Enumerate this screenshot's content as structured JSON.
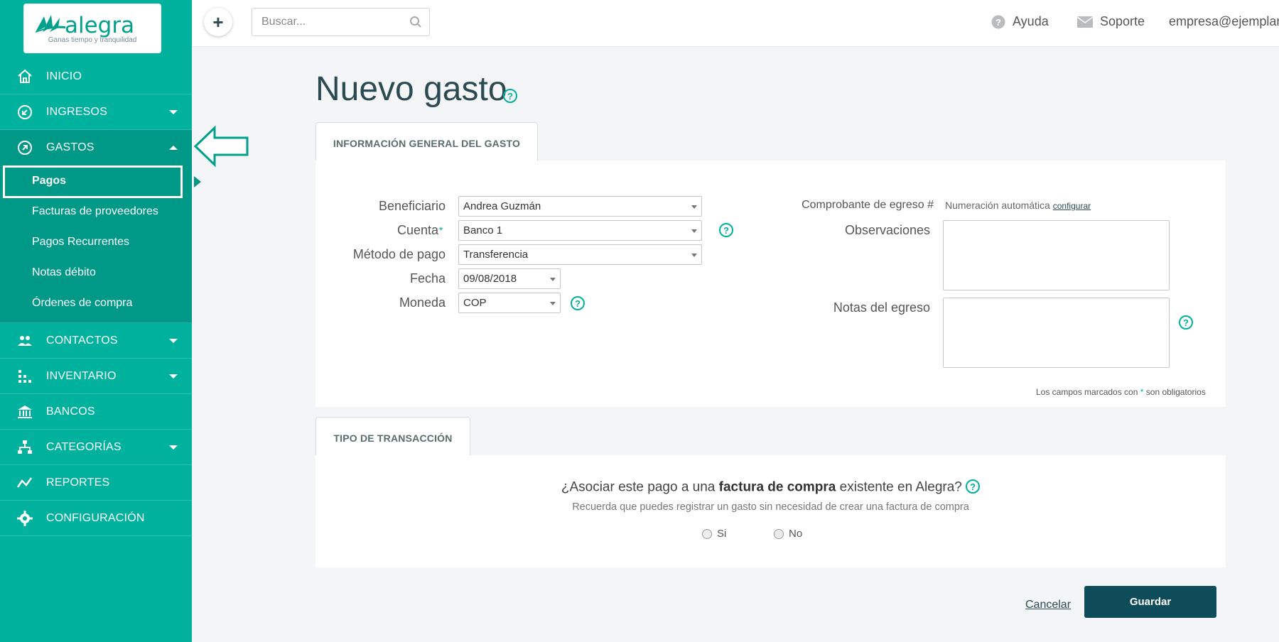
{
  "brand": {
    "name": "alegra",
    "tagline": "Ganas tiempo y tranquilidad",
    "primary_color": "#00b19d",
    "dark_color": "#0f4c5a"
  },
  "sidebar": {
    "items": [
      {
        "label": "INICIO",
        "icon": "home-icon"
      },
      {
        "label": "INGRESOS",
        "icon": "income-icon"
      },
      {
        "label": "GASTOS",
        "icon": "expense-icon"
      },
      {
        "label": "CONTACTOS",
        "icon": "contacts-icon"
      },
      {
        "label": "INVENTARIO",
        "icon": "inventory-icon"
      },
      {
        "label": "BANCOS",
        "icon": "bank-icon"
      },
      {
        "label": "CATEGORÍAS",
        "icon": "categories-icon"
      },
      {
        "label": "REPORTES",
        "icon": "reports-icon"
      },
      {
        "label": "CONFIGURACIÓN",
        "icon": "gear-icon"
      }
    ],
    "gastos_sub": [
      {
        "label": "Pagos"
      },
      {
        "label": "Facturas de proveedores"
      },
      {
        "label": "Pagos Recurrentes"
      },
      {
        "label": "Notas débito"
      },
      {
        "label": "Órdenes de compra"
      }
    ]
  },
  "topbar": {
    "add_label": "+",
    "search_placeholder": "Buscar...",
    "help_label": "Ayuda",
    "support_label": "Soporte",
    "user_email": "empresa@ejemplar."
  },
  "page": {
    "title": "Nuevo gasto"
  },
  "general_info": {
    "tab_label": "INFORMACIÓN GENERAL DEL GASTO",
    "beneficiario_label": "Beneficiario",
    "beneficiario_value": "Andrea Guzmán",
    "cuenta_label": "Cuenta",
    "cuenta_required": "*",
    "cuenta_value": "Banco 1",
    "metodo_label": "Método de pago",
    "metodo_value": "Transferencia",
    "fecha_label": "Fecha",
    "fecha_value": "09/08/2018",
    "moneda_label": "Moneda",
    "moneda_value": "COP",
    "comprobante_label": "Comprobante de egreso #",
    "numeracion_text": "Numeración automática",
    "configurar_link": "configurar",
    "observaciones_label": "Observaciones",
    "notas_label": "Notas del egreso",
    "required_note_prefix": "Los campos marcados con",
    "required_note_star": "*",
    "required_note_suffix": "son obligatorios"
  },
  "transaction": {
    "tab_label": "TIPO DE TRANSACCIÓN",
    "question_prefix": "¿Asociar este pago a una",
    "question_bold": "factura de compra",
    "question_suffix": "existente en Alegra?",
    "hint": "Recuerda que puedes registrar un gasto sin necesidad de crear una factura de compra",
    "option_yes": "Si",
    "option_no": "No"
  },
  "actions": {
    "cancel_label": "Cancelar",
    "save_label": "Guardar"
  }
}
